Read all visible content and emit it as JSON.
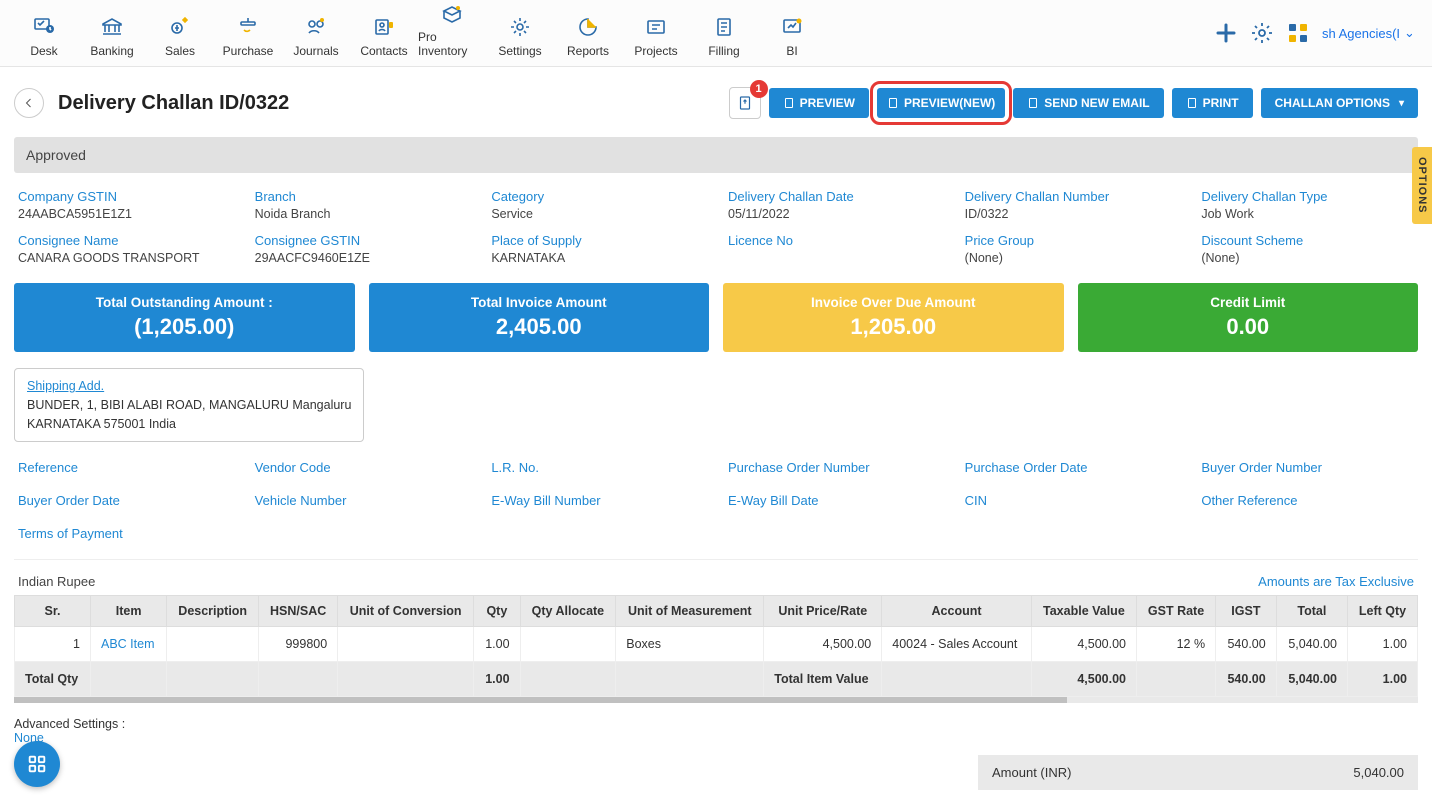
{
  "nav": {
    "items": [
      {
        "label": "Desk"
      },
      {
        "label": "Banking"
      },
      {
        "label": "Sales"
      },
      {
        "label": "Purchase"
      },
      {
        "label": "Journals"
      },
      {
        "label": "Contacts"
      },
      {
        "label": "Pro Inventory"
      },
      {
        "label": "Settings"
      },
      {
        "label": "Reports"
      },
      {
        "label": "Projects"
      },
      {
        "label": "Filling"
      },
      {
        "label": "BI"
      }
    ],
    "company_selector": "sh Agencies(I"
  },
  "options_tab": "OPTIONS",
  "title_row": {
    "page_title": "Delivery Challan ID/0322",
    "badge_count": "1",
    "buttons": {
      "preview": "PREVIEW",
      "preview_new": "PREVIEW(NEW)",
      "send_email": "SEND NEW EMAIL",
      "print": "PRINT",
      "challan_options": "CHALLAN OPTIONS"
    }
  },
  "status": "Approved",
  "details": {
    "row1": [
      {
        "label": "Company GSTIN",
        "value": "24AABCA5951E1Z1"
      },
      {
        "label": "Branch",
        "value": "Noida Branch"
      },
      {
        "label": "Category",
        "value": "Service"
      },
      {
        "label": "Delivery Challan Date",
        "value": "05/11/2022"
      },
      {
        "label": "Delivery Challan Number",
        "value": "ID/0322"
      },
      {
        "label": "Delivery Challan Type",
        "value": "Job Work"
      }
    ],
    "row2": [
      {
        "label": "Consignee Name",
        "value": "CANARA GOODS TRANSPORT",
        "link": true
      },
      {
        "label": "Consignee GSTIN",
        "value": "29AACFC9460E1ZE"
      },
      {
        "label": "Place of Supply",
        "value": "KARNATAKA"
      },
      {
        "label": "Licence No",
        "value": ""
      },
      {
        "label": "Price Group",
        "value": "(None)"
      },
      {
        "label": "Discount Scheme",
        "value": "(None)"
      }
    ]
  },
  "summary": [
    {
      "label": "Total Outstanding Amount :",
      "value": "(1,205.00)",
      "color": "sc-blue"
    },
    {
      "label": "Total Invoice Amount",
      "value": "2,405.00",
      "color": "sc-blue"
    },
    {
      "label": "Invoice Over Due Amount",
      "value": "1,205.00",
      "color": "sc-yellow"
    },
    {
      "label": "Credit Limit",
      "value": "0.00",
      "color": "sc-green"
    }
  ],
  "shipping": {
    "title": "Shipping Add.",
    "line1": "BUNDER, 1, BIBI ALABI ROAD, MANGALURU Mangaluru",
    "line2": "KARNATAKA 575001 India"
  },
  "meta_labels": [
    "Reference",
    "Vendor Code",
    "L.R. No.",
    "Purchase Order Number",
    "Purchase Order Date",
    "Buyer Order Number",
    "Buyer Order Date",
    "Vehicle Number",
    "E-Way Bill Number",
    "E-Way Bill Date",
    "CIN",
    "Other Reference",
    "Terms of Payment"
  ],
  "currency": {
    "left": "Indian Rupee",
    "right": "Amounts are Tax Exclusive"
  },
  "table": {
    "headers": [
      "Sr.",
      "Item",
      "Description",
      "HSN/SAC",
      "Unit of Conversion",
      "Qty",
      "Qty Allocate",
      "Unit of Measurement",
      "Unit Price/Rate",
      "Account",
      "Taxable Value",
      "GST Rate",
      "IGST",
      "Total",
      "Left Qty"
    ],
    "rows": [
      {
        "sr": "1",
        "item": "ABC Item",
        "desc": "",
        "hsn": "999800",
        "uoc": "",
        "qty": "1.00",
        "qalloc": "",
        "uom": "Boxes",
        "rate": "4,500.00",
        "account": "40024 - Sales Account",
        "taxable": "4,500.00",
        "gst": "12 %",
        "igst": "540.00",
        "total": "5,040.00",
        "left": "1.00"
      }
    ],
    "footer": {
      "label_left": "Total Qty",
      "qty": "1.00",
      "label_mid": "Total Item Value",
      "taxable": "4,500.00",
      "igst": "540.00",
      "total": "5,040.00",
      "left": "1.00"
    }
  },
  "advanced": {
    "label": "Advanced Settings :",
    "value": "None"
  },
  "totals": {
    "label": "Amount (INR)",
    "value": "5,040.00"
  }
}
